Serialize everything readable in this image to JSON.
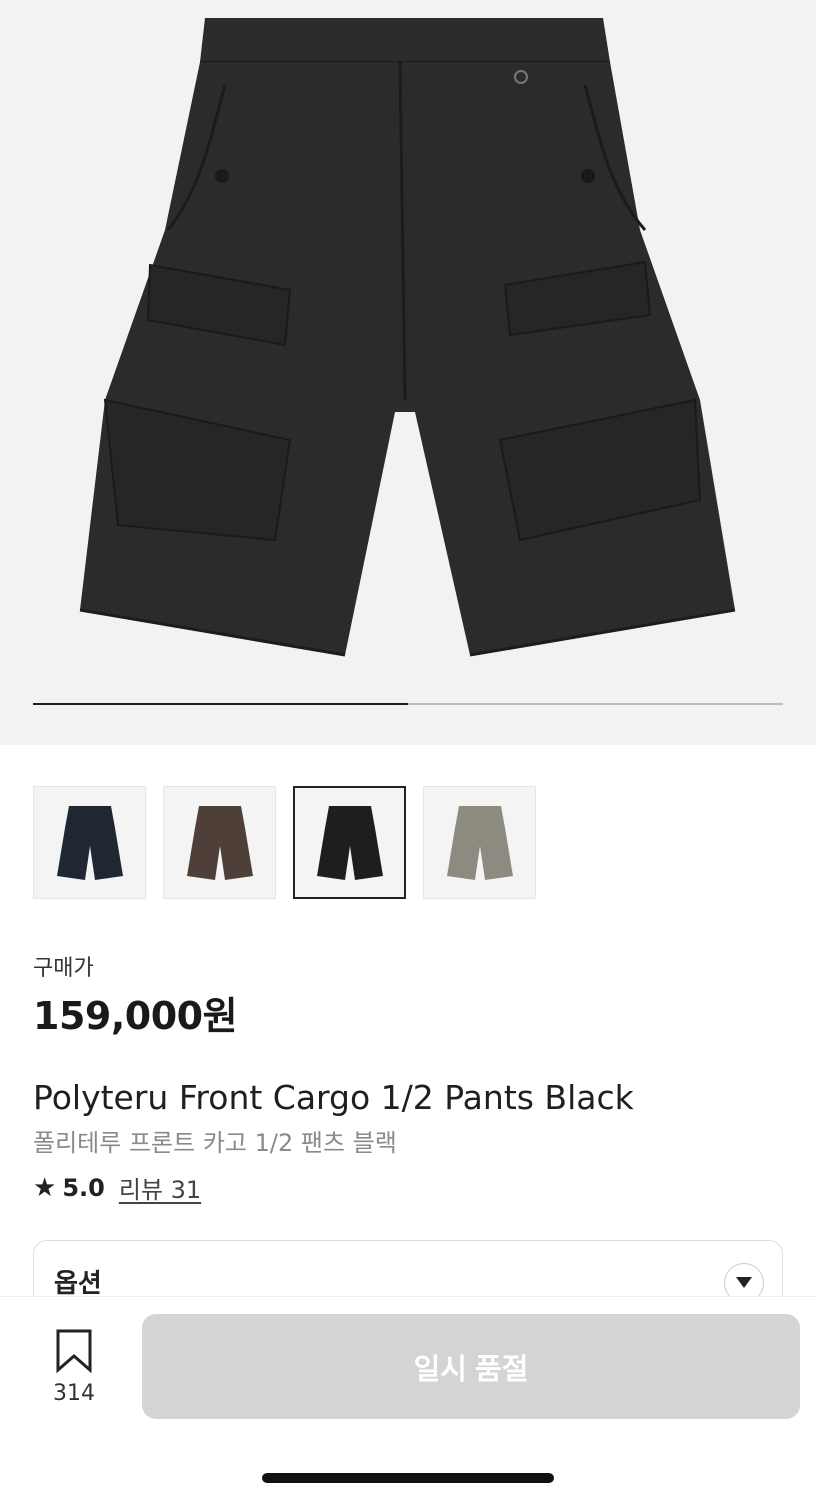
{
  "gallery": {
    "image_alt": "Polyteru Front Cargo 1/2 Pants Black",
    "progress": 0.5,
    "thumbnails": [
      {
        "color": "#1f2733",
        "name": "navy"
      },
      {
        "color": "#4e3f39",
        "name": "brown"
      },
      {
        "color": "#1e1e1e",
        "name": "black"
      },
      {
        "color": "#8d8b80",
        "name": "grey"
      }
    ],
    "selected_index": 2
  },
  "price": {
    "label": "구매가",
    "value": "159,000원"
  },
  "product": {
    "name_en": "Polyteru Front Cargo 1/2 Pants Black",
    "name_ko": "폴리테루 프론트 카고 1/2 팬츠 블랙",
    "rating": "5.0",
    "review_label": "리뷰 31"
  },
  "option": {
    "label": "옵션"
  },
  "bottom": {
    "bookmark_count": "314",
    "soldout_label": "일시 품절"
  },
  "colors": {
    "accent": "#222222",
    "disabled_button": "#d4d4d4",
    "hero_bg": "#f2f2f2"
  }
}
